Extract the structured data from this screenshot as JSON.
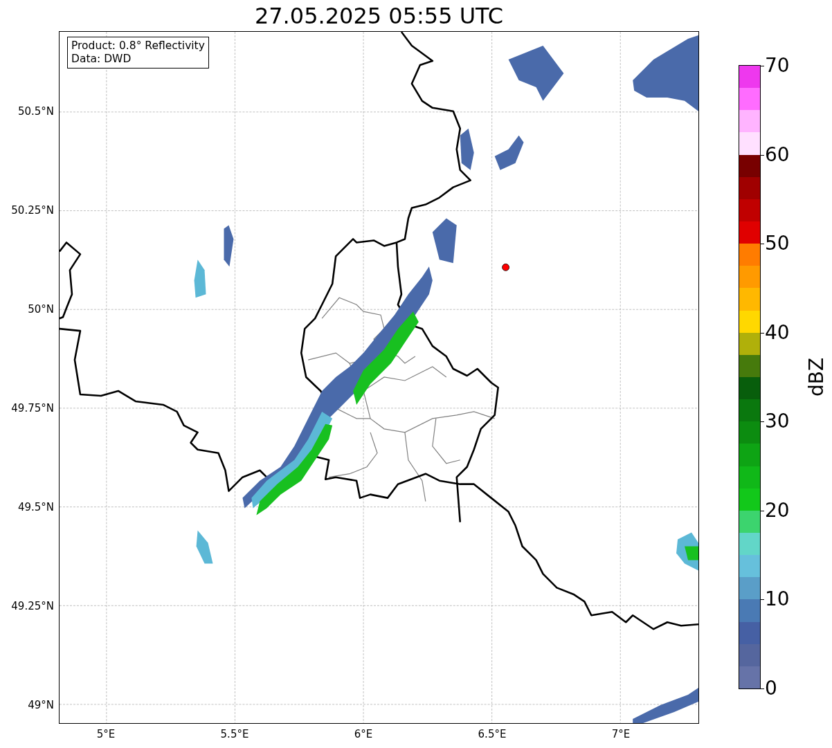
{
  "title": "27.05.2025 05:55 UTC",
  "legend": [
    "Product: 0.8° Reflectivity",
    "Data: DWD"
  ],
  "y_ticks": [
    "50.5°N",
    "50.25°N",
    "50°N",
    "49.75°N",
    "49.5°N",
    "49.25°N",
    "49°N"
  ],
  "x_ticks": [
    "5°E",
    "5.5°E",
    "6°E",
    "6.5°E",
    "7°E"
  ],
  "colorbar": {
    "label": "dBZ",
    "ticks": [
      "70",
      "60",
      "50",
      "40",
      "30",
      "20",
      "10",
      "0"
    ],
    "bands": [
      {
        "color": "#ee38ee"
      },
      {
        "color": "#ff6cff"
      },
      {
        "color": "#ffb4ff"
      },
      {
        "color": "#ffe0ff"
      },
      {
        "color": "#780000"
      },
      {
        "color": "#a00000"
      },
      {
        "color": "#c00000"
      },
      {
        "color": "#e00000"
      },
      {
        "color": "#ff7c00"
      },
      {
        "color": "#ff9a00"
      },
      {
        "color": "#ffb800"
      },
      {
        "color": "#ffd800"
      },
      {
        "color": "#b0b00a"
      },
      {
        "color": "#467a0c"
      },
      {
        "color": "#085e0c"
      },
      {
        "color": "#0a780e"
      },
      {
        "color": "#0c8c10"
      },
      {
        "color": "#0ea414"
      },
      {
        "color": "#10b818"
      },
      {
        "color": "#12c81a"
      },
      {
        "color": "#3cd46e"
      },
      {
        "color": "#62d6c8"
      },
      {
        "color": "#66c0dc"
      },
      {
        "color": "#5a9ec8"
      },
      {
        "color": "#4a7ab4"
      },
      {
        "color": "#4660a4"
      },
      {
        "color": "#55669e"
      },
      {
        "color": "#6673a8"
      }
    ]
  }
}
